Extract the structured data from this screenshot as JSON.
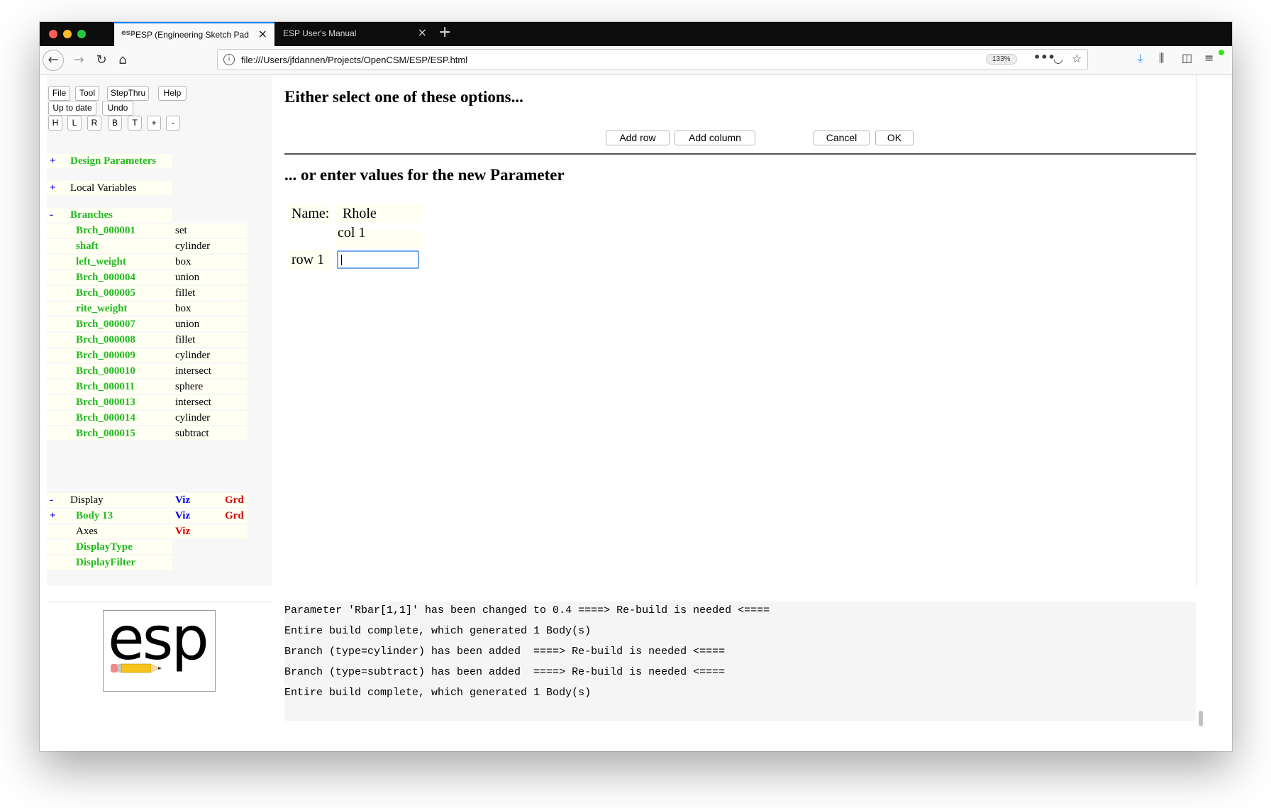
{
  "tabs": [
    {
      "favicon": "esp",
      "title": "ESP (Engineering Sketch Pad, V",
      "close": "×"
    },
    {
      "title": "ESP User's Manual",
      "close": "×"
    }
  ],
  "newtab": "+",
  "nav": {
    "back": "←",
    "forward": "→",
    "reload": "↻",
    "home": "⌂",
    "info": "i",
    "url": "file:///Users/jfdannen/Projects/OpenCSM/ESP/ESP.html",
    "zoom": "133%",
    "more": "•••",
    "pocket": "◡",
    "star": "☆",
    "download": "⤓",
    "library": "⫼",
    "sidebar": "◫",
    "menu": "≡"
  },
  "toolbar": {
    "file": "File",
    "tool": "Tool",
    "stepthru": "StepThru",
    "help": "Help",
    "uptodate": "Up to date",
    "undo": "Undo",
    "views": [
      "H",
      "L",
      "R",
      "B",
      "T",
      "+",
      "-"
    ]
  },
  "tree": {
    "design_params": {
      "toggle": "+",
      "label": "Design Parameters"
    },
    "local_vars": {
      "toggle": "+",
      "label": "Local Variables"
    },
    "branches": {
      "toggle": "-",
      "label": "Branches",
      "items": [
        {
          "name": "Brch_000001",
          "type": "set"
        },
        {
          "name": "shaft",
          "type": "cylinder"
        },
        {
          "name": "left_weight",
          "type": "box"
        },
        {
          "name": "Brch_000004",
          "type": "union"
        },
        {
          "name": "Brch_000005",
          "type": "fillet"
        },
        {
          "name": "rite_weight",
          "type": "box"
        },
        {
          "name": "Brch_000007",
          "type": "union"
        },
        {
          "name": "Brch_000008",
          "type": "fillet"
        },
        {
          "name": "Brch_000009",
          "type": "cylinder"
        },
        {
          "name": "Brch_000010",
          "type": "intersect"
        },
        {
          "name": "Brch_000011",
          "type": "sphere"
        },
        {
          "name": "Brch_000013",
          "type": "intersect"
        },
        {
          "name": "Brch_000014",
          "type": "cylinder"
        },
        {
          "name": "Brch_000015",
          "type": "subtract"
        }
      ]
    },
    "display": {
      "toggle": "-",
      "label": "Display",
      "viz": "Viz",
      "grd": "Grd"
    },
    "body": {
      "toggle": "+",
      "label": "Body 13",
      "viz": "Viz",
      "grd": "Grd"
    },
    "axes": {
      "label": "Axes",
      "viz": "Viz"
    },
    "display_type": "DisplayType",
    "display_filter": "DisplayFilter"
  },
  "main": {
    "options_heading": "Either select one of these options...",
    "add_row": "Add row",
    "add_column": "Add column",
    "cancel": "Cancel",
    "ok": "OK",
    "values_heading": "... or enter values for the new Parameter",
    "name_label": "Name:",
    "name_value": "Rhole",
    "col_header": "col 1",
    "row_label": "row 1",
    "row_value": ""
  },
  "logo": {
    "text": "esp"
  },
  "messages": [
    "Parameter 'Rbar[1,1]' has been changed to 0.4 ====> Re-build is needed <====",
    "Entire build complete, which generated 1 Body(s)",
    "Branch (type=cylinder) has been added  ====> Re-build is needed <====",
    "Branch (type=subtract) has been added  ====> Re-build is needed <====",
    "Entire build complete, which generated 1 Body(s)"
  ],
  "colors": {
    "branch_green": "#22bb22",
    "viz_blue": "#0000ee",
    "grd_red": "#dd0000",
    "tab_accent": "#0a84ff"
  }
}
